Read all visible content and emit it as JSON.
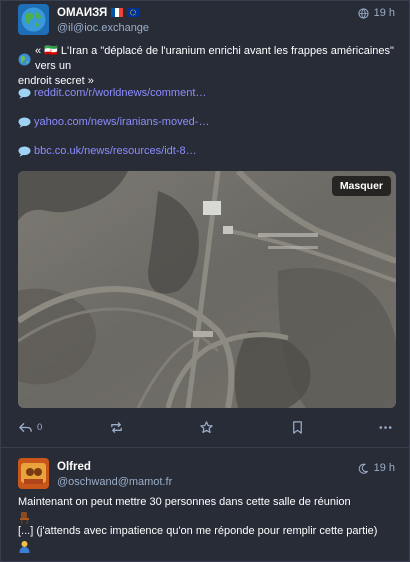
{
  "posts": [
    {
      "display_name": "ОМАИЗЯ",
      "handle": "@il@ioc.exchange",
      "time": "19 h",
      "time_icon": "globe-icon",
      "text_line1": "« 🇮🇷 L'Iran a \"déplacé de l'uranium enrichi avant les frappes américaines\" vers un",
      "text_line2": "endroit secret »",
      "links": [
        "reddit.com/r/worldnews/comment…",
        "yahoo.com/news/iranians-moved-…",
        "bbc.co.uk/news/resources/idt-8…"
      ],
      "media_hide_label": "Masquer",
      "actions": {
        "reply_count": "0"
      }
    },
    {
      "display_name": "Olfred",
      "handle": "@oschwand@mamot.fr",
      "time": "19 h",
      "time_icon": "moon-icon",
      "text_line1": "Maintenant on peut mettre 30 personnes dans cette salle de réunion",
      "text_line2": "[...] (j'attends avec impatience qu'on me réponde pour remplir cette partie)"
    }
  ]
}
